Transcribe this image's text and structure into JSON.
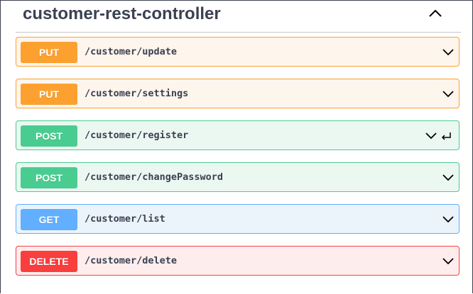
{
  "tag": {
    "title": "customer-rest-controller",
    "collapse_icon": "chevron-up-icon"
  },
  "operations": [
    {
      "method": "PUT",
      "path": "/customer/update",
      "color": "#fca130"
    },
    {
      "method": "PUT",
      "path": "/customer/settings",
      "color": "#fca130"
    },
    {
      "method": "POST",
      "path": "/customer/register",
      "color": "#49cc90"
    },
    {
      "method": "POST",
      "path": "/customer/changePassword",
      "color": "#49cc90"
    },
    {
      "method": "GET",
      "path": "/customer/list",
      "color": "#61affe"
    },
    {
      "method": "DELETE",
      "path": "/customer/delete",
      "color": "#f93e3e"
    }
  ],
  "icons": {
    "expand": "chevron-down-icon",
    "enter": "enter-icon"
  }
}
